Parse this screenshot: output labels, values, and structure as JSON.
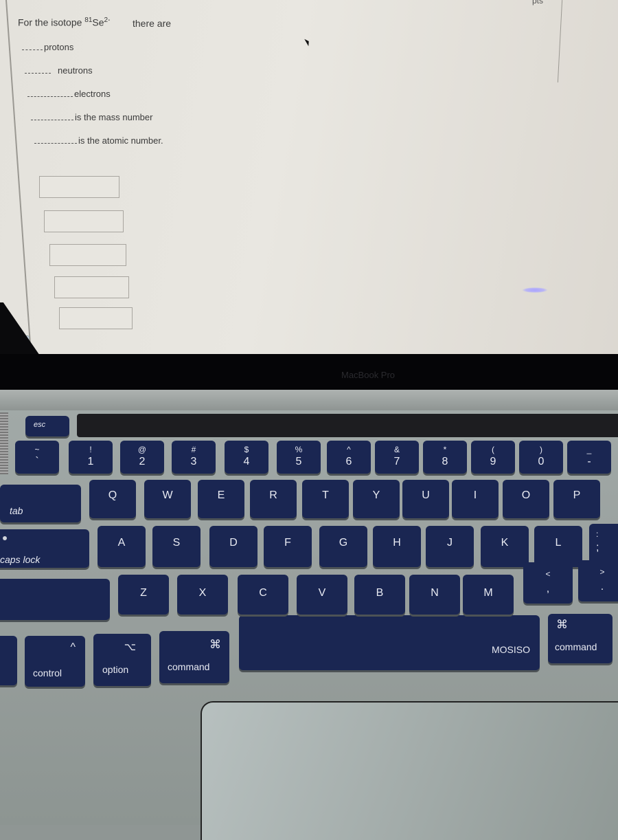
{
  "question": {
    "prefix": "For the isotope ",
    "mass_superscript": "81",
    "symbol": "Se",
    "charge_superscript": "2-",
    "suffix": "there are",
    "blanks": [
      {
        "label": "protons",
        "value": ""
      },
      {
        "label": "neutrons",
        "value": ""
      },
      {
        "label": "electrons",
        "value": ""
      },
      {
        "label": "is the mass number",
        "value": ""
      },
      {
        "label": "is the atomic number.",
        "value": ""
      }
    ],
    "answer_fields": [
      "",
      "",
      "",
      "",
      ""
    ]
  },
  "screen": {
    "top_right_fragment": "pts"
  },
  "laptop": {
    "brand_label": "MacBook Pro",
    "cover_brand": "MOSISO"
  },
  "keyboard": {
    "esc": "esc",
    "tab": "tab",
    "caps_lock": "caps lock",
    "control": "control",
    "control_symbol": "^",
    "option": "option",
    "option_symbol": "⌥",
    "command_left": "command",
    "command_right": "command",
    "command_symbol": "⌘",
    "number_row": [
      {
        "lower": "`",
        "upper": "~"
      },
      {
        "lower": "1",
        "upper": "!"
      },
      {
        "lower": "2",
        "upper": "@"
      },
      {
        "lower": "3",
        "upper": "#"
      },
      {
        "lower": "4",
        "upper": "$"
      },
      {
        "lower": "5",
        "upper": "%"
      },
      {
        "lower": "6",
        "upper": "^"
      },
      {
        "lower": "7",
        "upper": "&"
      },
      {
        "lower": "8",
        "upper": "*"
      },
      {
        "lower": "9",
        "upper": "("
      },
      {
        "lower": "0",
        "upper": ")"
      },
      {
        "lower": "-",
        "upper": "_"
      }
    ],
    "row_q": [
      "Q",
      "W",
      "E",
      "R",
      "T",
      "Y",
      "U",
      "I",
      "O",
      "P"
    ],
    "row_a": [
      "A",
      "S",
      "D",
      "F",
      "G",
      "H",
      "J",
      "K",
      "L"
    ],
    "row_a_extra": {
      "lower": ";",
      "upper": ":"
    },
    "row_z": [
      "Z",
      "X",
      "C",
      "V",
      "B",
      "N",
      "M"
    ],
    "comma": {
      "lower": ",",
      "upper": "<"
    },
    "period": {
      "lower": ".",
      "upper": ">"
    }
  }
}
